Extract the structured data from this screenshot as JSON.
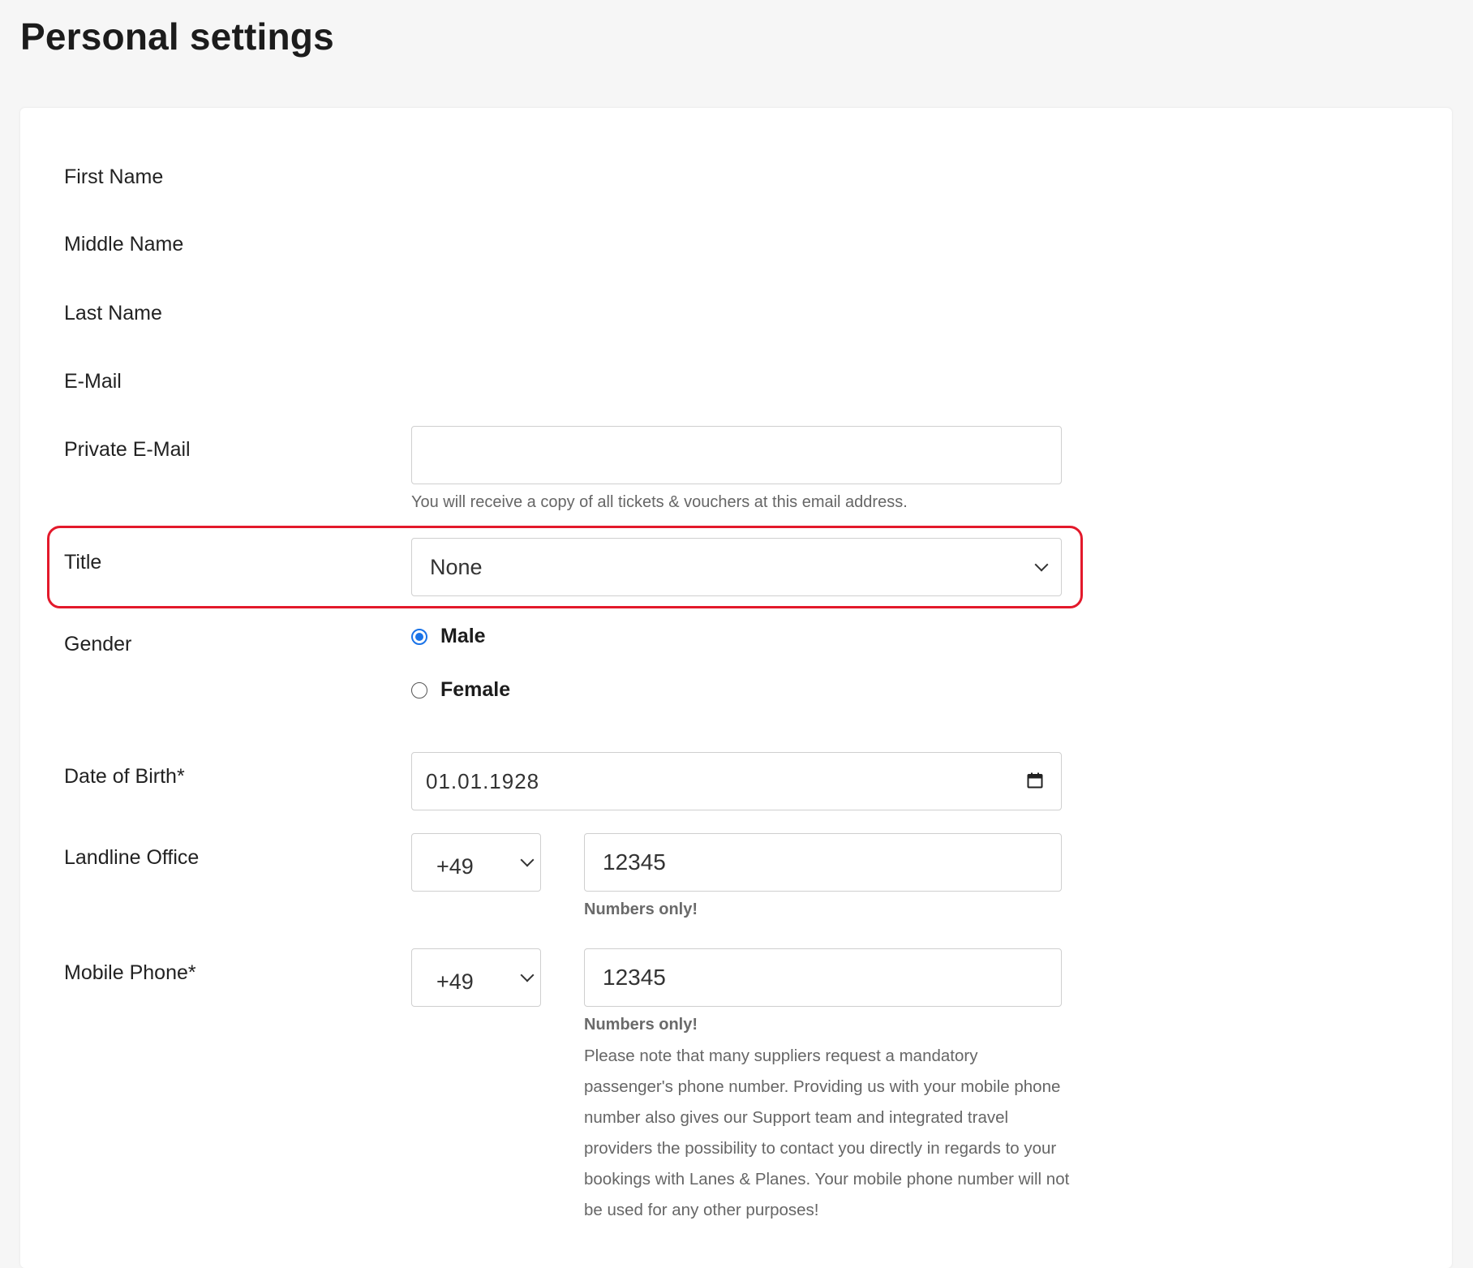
{
  "page": {
    "title": "Personal settings"
  },
  "form": {
    "first_name_label": "First Name",
    "middle_name_label": "Middle Name",
    "last_name_label": "Last Name",
    "email_label": "E-Mail",
    "private_email": {
      "label": "Private E-Mail",
      "value": "",
      "help": "You will receive a copy of all tickets & vouchers at this email address."
    },
    "title": {
      "label": "Title",
      "selected": "None"
    },
    "gender": {
      "label": "Gender",
      "options": [
        {
          "label": "Male",
          "checked": true
        },
        {
          "label": "Female",
          "checked": false
        }
      ]
    },
    "date_of_birth": {
      "label": "Date of Birth*",
      "value": "01.01.1928"
    },
    "landline_office": {
      "label": "Landline Office",
      "country_code": "+49",
      "number": "12345",
      "help": "Numbers only!"
    },
    "mobile_phone": {
      "label": "Mobile Phone*",
      "country_code": "+49",
      "number": "12345",
      "help": "Numbers only!",
      "note": "Please note that many suppliers request a mandatory passenger's phone number. Providing us with your mobile phone number also gives our Support team and integrated travel providers the possibility to contact you directly in regards to your bookings with Lanes & Planes. Your mobile phone number will not be used for any other purposes!"
    }
  },
  "colors": {
    "highlight": "#e3192b",
    "radio_accent": "#1a73e8",
    "background": "#f6f6f6"
  },
  "icons": {
    "select_arrow": "chevron-down-icon",
    "date_picker": "calendar-icon"
  }
}
